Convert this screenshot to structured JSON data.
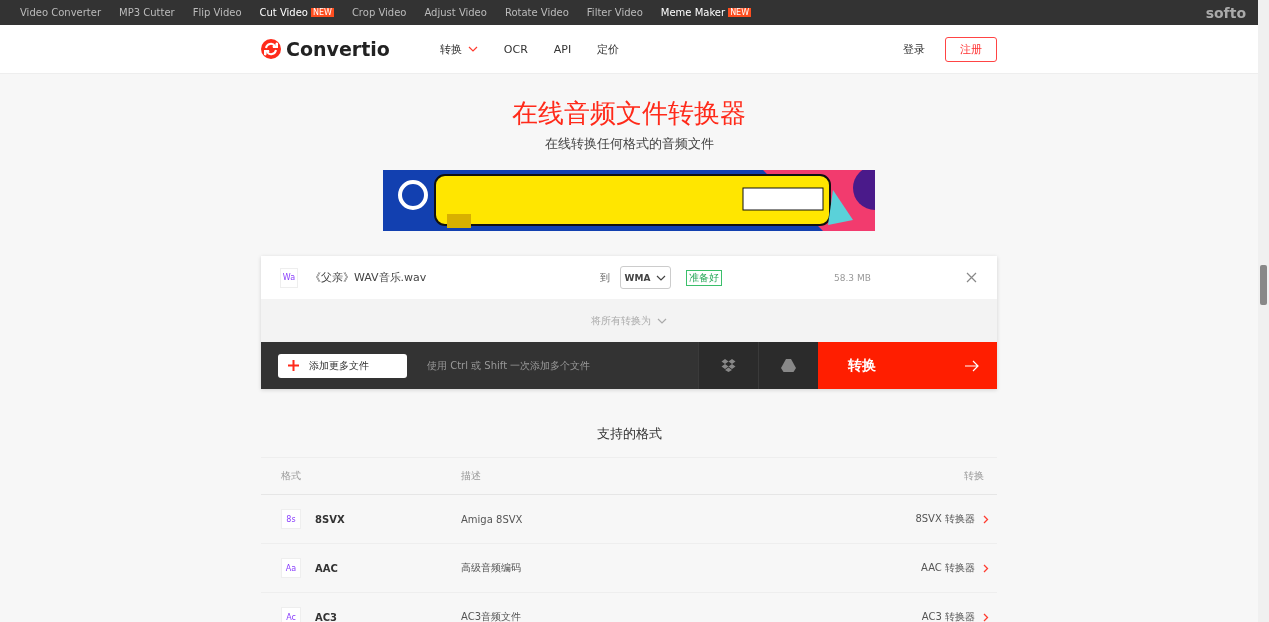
{
  "top_links": [
    {
      "label": "Video Converter",
      "highlighted": false
    },
    {
      "label": "MP3 Cutter",
      "highlighted": false
    },
    {
      "label": "Flip Video",
      "highlighted": false
    },
    {
      "label": "Cut Video",
      "highlighted": true,
      "badge": "NEW"
    },
    {
      "label": "Crop Video",
      "highlighted": false
    },
    {
      "label": "Adjust Video",
      "highlighted": false
    },
    {
      "label": "Rotate Video",
      "highlighted": false
    },
    {
      "label": "Filter Video",
      "highlighted": false
    },
    {
      "label": "Meme Maker",
      "highlighted": true,
      "badge": "NEW"
    }
  ],
  "top_brand": "softo",
  "header": {
    "logo": "Convertio",
    "nav": [
      {
        "label": "转换",
        "dropdown": true
      },
      {
        "label": "OCR",
        "dropdown": false
      },
      {
        "label": "API",
        "dropdown": false
      },
      {
        "label": "定价",
        "dropdown": false
      }
    ],
    "login": "登录",
    "register": "注册"
  },
  "title": "在线音频文件转换器",
  "subtitle": "在线转换任何格式的音频文件",
  "file": {
    "icon": "Wa",
    "name": "《父亲》WAV音乐.wav",
    "to": "到",
    "format": "WMA",
    "status": "准备好",
    "size": "58.3 MB"
  },
  "convert_all": "将所有转换为",
  "add_button": "添加更多文件",
  "add_hint": "使用 Ctrl 或 Shift 一次添加多个文件",
  "convert_button": "转换",
  "formats": {
    "title": "支持的格式",
    "columns": [
      "格式",
      "描述",
      "转换"
    ],
    "rows": [
      {
        "icon": "8s",
        "name": "8SVX",
        "description": "Amiga 8SVX",
        "link": "8SVX 转换器"
      },
      {
        "icon": "Aa",
        "name": "AAC",
        "description": "高级音频编码",
        "link": "AAC 转换器"
      },
      {
        "icon": "Ac",
        "name": "AC3",
        "description": "AC3音频文件",
        "link": "AC3 转换器"
      }
    ]
  }
}
